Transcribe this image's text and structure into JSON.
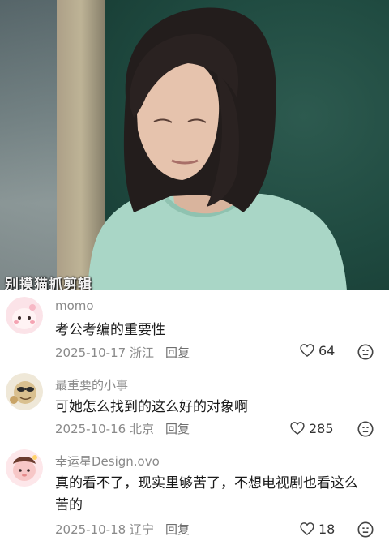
{
  "video": {
    "watermark": "别摸猫抓剪辑"
  },
  "comments": [
    {
      "username": "momo",
      "text": "考公考编的重要性",
      "date_location": "2025-10-17 浙江",
      "reply_label": "回复",
      "likes": "64"
    },
    {
      "username": "最重要的小事",
      "text": "可她怎么找到的这么好的对象啊",
      "date_location": "2025-10-16 北京",
      "reply_label": "回复",
      "likes": "285"
    },
    {
      "username": "幸运星Design.ovo",
      "text_line1": "真的看不了，现实里够苦了，不想电视剧也看这么",
      "text_line2": "苦的",
      "date_location": "2025-10-18 辽宁",
      "reply_label": "回复",
      "likes": "18"
    }
  ],
  "colors": {
    "username": "#8a8a8a",
    "text": "#1a1a1a",
    "meta": "#8a8a8a",
    "icon": "#444444"
  }
}
